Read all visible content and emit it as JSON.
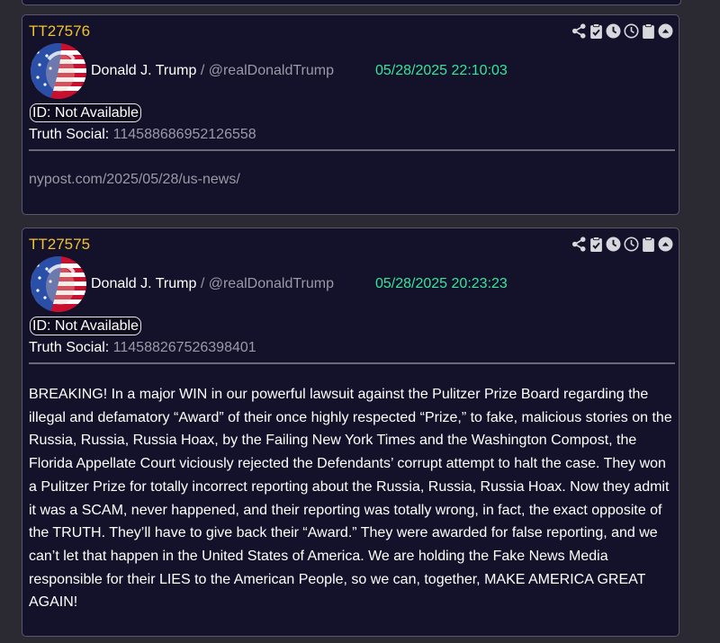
{
  "posts": [
    {
      "tt_id": "TT27576",
      "author_name": "Donald J. Trump",
      "separator": " / ",
      "handle": "@realDonaldTrump",
      "timestamp": "05/28/2025 22:10:03",
      "id_badge": "ID: Not Available",
      "truth_label": "Truth Social:",
      "truth_id": "114588686952126558",
      "link": "nypost.com/2025/05/28/us-news/"
    },
    {
      "tt_id": "TT27575",
      "author_name": "Donald J. Trump",
      "separator": " / ",
      "handle": "@realDonaldTrump",
      "timestamp": "05/28/2025 20:23:23",
      "id_badge": "ID: Not Available",
      "truth_label": "Truth Social:",
      "truth_id": "114588267526398401",
      "body": "BREAKING! In a major WIN in our powerful lawsuit against the Pulitzer Prize Board regarding the illegal and defamatory “Award” of their once highly respected “Prize,” to fake, malicious stories on the Russia, Russia, Russia Hoax, by the Failing New York Times and the Washington Compost, the Florida Appellate Court viciously rejected the Defendants’ corrupt attempt to halt the case. They won a Pulitzer Prize for totally incorrect reporting about the Russia, Russia, Russia Hoax. Now they admit it was a SCAM, never happened, and their reporting was totally wrong, in fact, the exact opposite of the TRUTH. They’ll have to give back their “Award.” They were awarded for false reporting, and we can’t let that happen in the United States of America. We are holding the Fake News Media responsible for their LIES to the American People, so we can, together, MAKE AMERICA GREAT AGAIN!"
    }
  ],
  "icons": [
    "share-icon",
    "clipboard-check-icon",
    "clock-filled-icon",
    "clock-outline-icon",
    "clipboard-icon",
    "chevron-up-circle-icon"
  ],
  "colors": {
    "background": "#2b2a33",
    "card": "#14112a",
    "tt_id": "#f2c230",
    "timestamp": "#33e69a",
    "muted": "#9a9aa6"
  }
}
